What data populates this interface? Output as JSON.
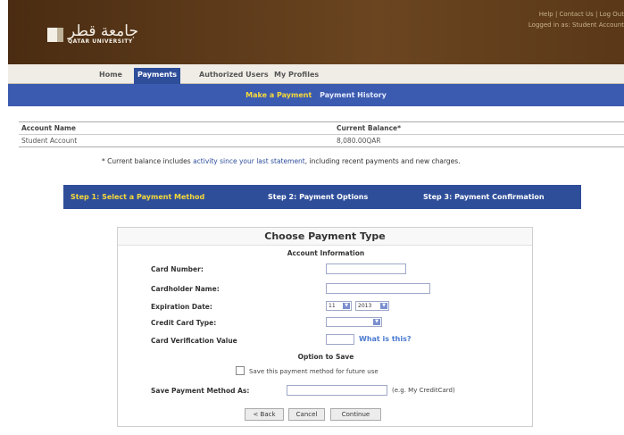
{
  "header": {
    "logo_arabic": "جامعة قطر",
    "logo_english": "QATAR UNIVERSITY",
    "links_line1": "Help | Contact Us | Log Out",
    "links_line2": "Logged in as: Student Account"
  },
  "tabs": [
    {
      "label": "Home"
    },
    {
      "label": "Payments"
    },
    {
      "label": "Authorized Users"
    },
    {
      "label": "My Profiles"
    }
  ],
  "subnav": {
    "make_payment": "Make a Payment",
    "payment_history": "Payment History"
  },
  "account_table": {
    "headers": [
      "Account Name",
      "Current Balance*"
    ],
    "rows": [
      {
        "name": "Student Account",
        "balance": "8,080.00QAR"
      }
    ]
  },
  "note": {
    "prefix": "* Current balance includes ",
    "link": "activity since your last statement",
    "suffix": ", including recent payments and new charges."
  },
  "steps": {
    "step1": "Step 1: Select a Payment Method",
    "step2": "Step 2: Payment Options",
    "step3": "Step 3: Payment Confirmation"
  },
  "form": {
    "title": "Choose Payment Type",
    "section_account": "Account Information",
    "card_number_label": "Card Number:",
    "card_number_value": "",
    "cardholder_label": "Cardholder Name:",
    "cardholder_value": "",
    "expiration_label": "Expiration Date:",
    "exp_month": "11",
    "exp_year": "2013",
    "card_type_label": "Credit Card Type:",
    "card_type_value": "",
    "cvv_label": "Card Verification Value",
    "cvv_value": "",
    "what_is_this": "What is this?",
    "section_save": "Option to Save",
    "save_checkbox_label": "Save this payment method for future use",
    "save_as_label": "Save Payment Method As:",
    "save_as_value": "",
    "save_as_hint": "(e.g. My CreditCard)",
    "back_button": "< Back",
    "cancel_button": "Cancel",
    "continue_button": "Continue"
  },
  "colors": {
    "banner": "#5a3a1a",
    "nav_blue": "#3b5bb0",
    "active_yellow": "#f5d93a"
  }
}
